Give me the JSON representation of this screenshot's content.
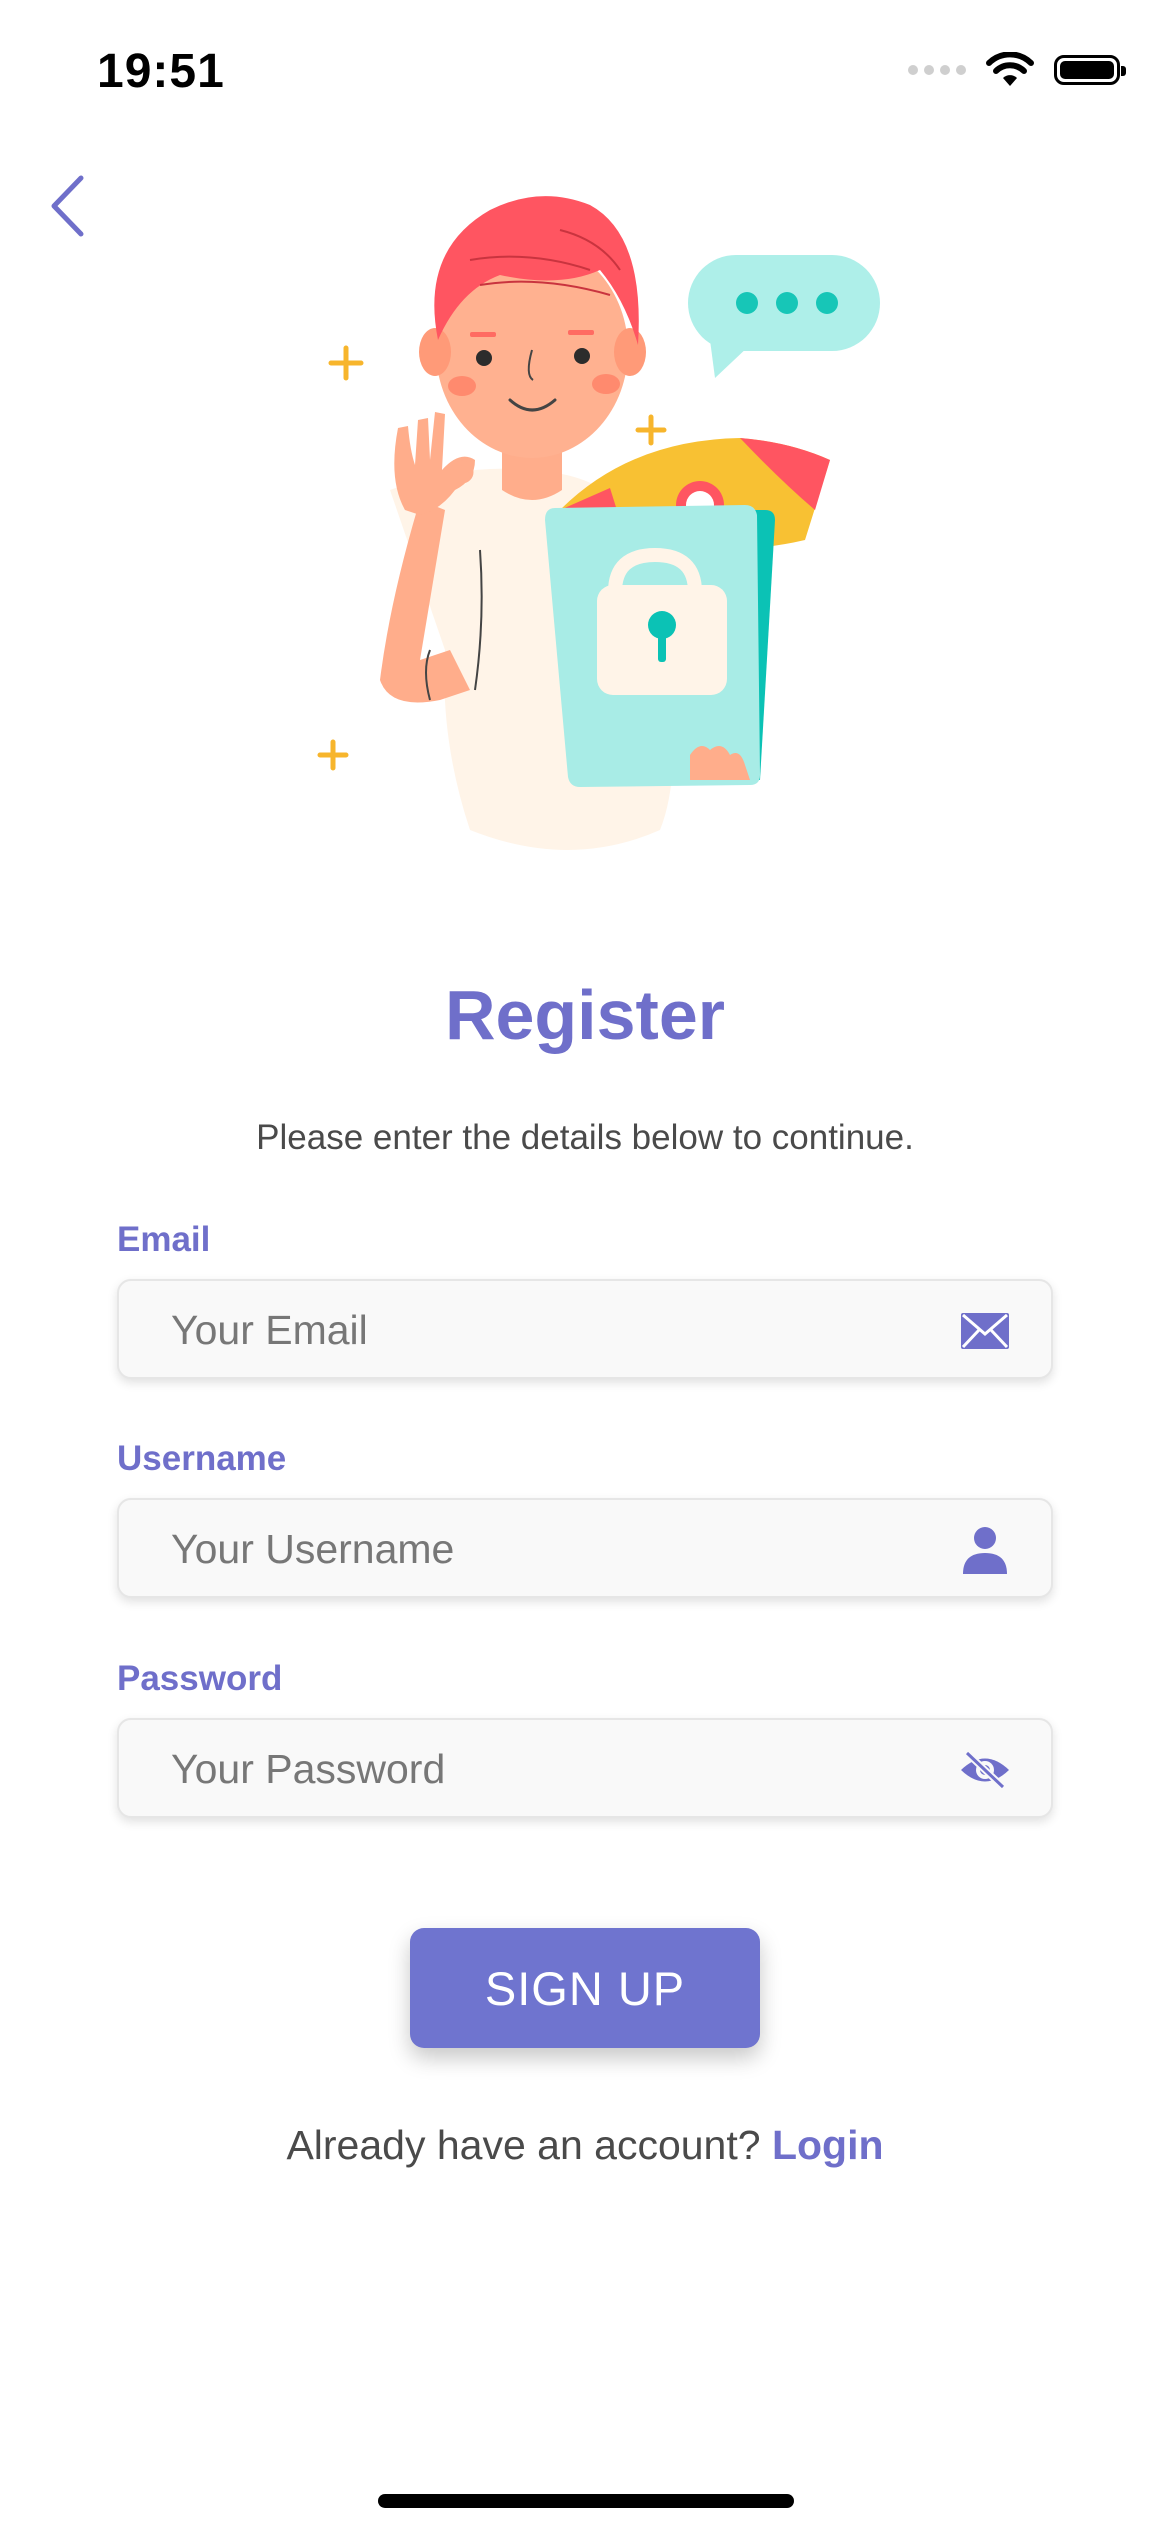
{
  "status_bar": {
    "time": "19:51"
  },
  "screen": {
    "title": "Register",
    "subtitle": "Please enter the details below to continue."
  },
  "form": {
    "email": {
      "label": "Email",
      "placeholder": "Your Email",
      "value": "",
      "icon": "mail-icon"
    },
    "username": {
      "label": "Username",
      "placeholder": "Your Username",
      "value": "",
      "icon": "user-icon"
    },
    "password": {
      "label": "Password",
      "placeholder": "Your Password",
      "value": "",
      "icon": "eye-off-icon"
    }
  },
  "signup_button": {
    "label": "SIGN UP"
  },
  "footer": {
    "prompt": "Already have an account?",
    "link": "Login"
  },
  "colors": {
    "accent": "#6F6FCA",
    "button": "#6F74CF",
    "hair": "#FF5561",
    "folder": "#A8ECE6",
    "teal": "#0BC2B5"
  }
}
